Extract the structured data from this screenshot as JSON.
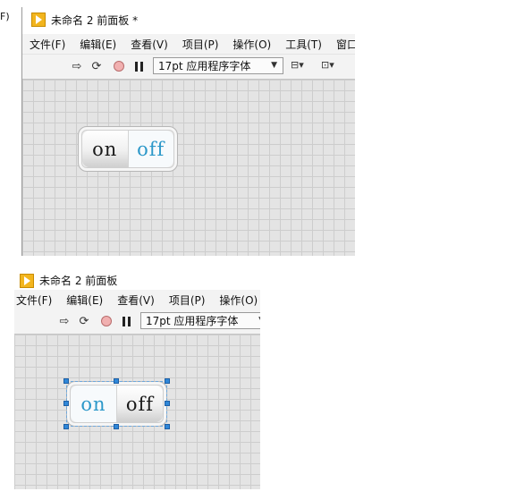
{
  "top_window": {
    "edge_fragment": "F)",
    "title": "未命名 2 前面板 *",
    "menu": [
      "文件(F)",
      "编辑(E)",
      "查看(V)",
      "项目(P)",
      "操作(O)",
      "工具(T)",
      "窗口(W"
    ],
    "toolbar": {
      "font_label": "17pt 应用程序字体"
    },
    "switch": {
      "left_label": "on",
      "right_label": "off",
      "state": "off"
    }
  },
  "bottom_window": {
    "title_partial": "未命名 2 前面板",
    "menu": [
      "文件(F)",
      "编辑(E)",
      "查看(V)",
      "项目(P)",
      "操作(O)"
    ],
    "toolbar": {
      "font_label": "17pt 应用程序字体"
    },
    "switch": {
      "left_label": "on",
      "right_label": "off",
      "state": "on",
      "selected": true
    }
  },
  "colors": {
    "accent_text": "#2c98c9",
    "selection_handle": "#2f87d8",
    "app_icon": "#f2b51e"
  }
}
